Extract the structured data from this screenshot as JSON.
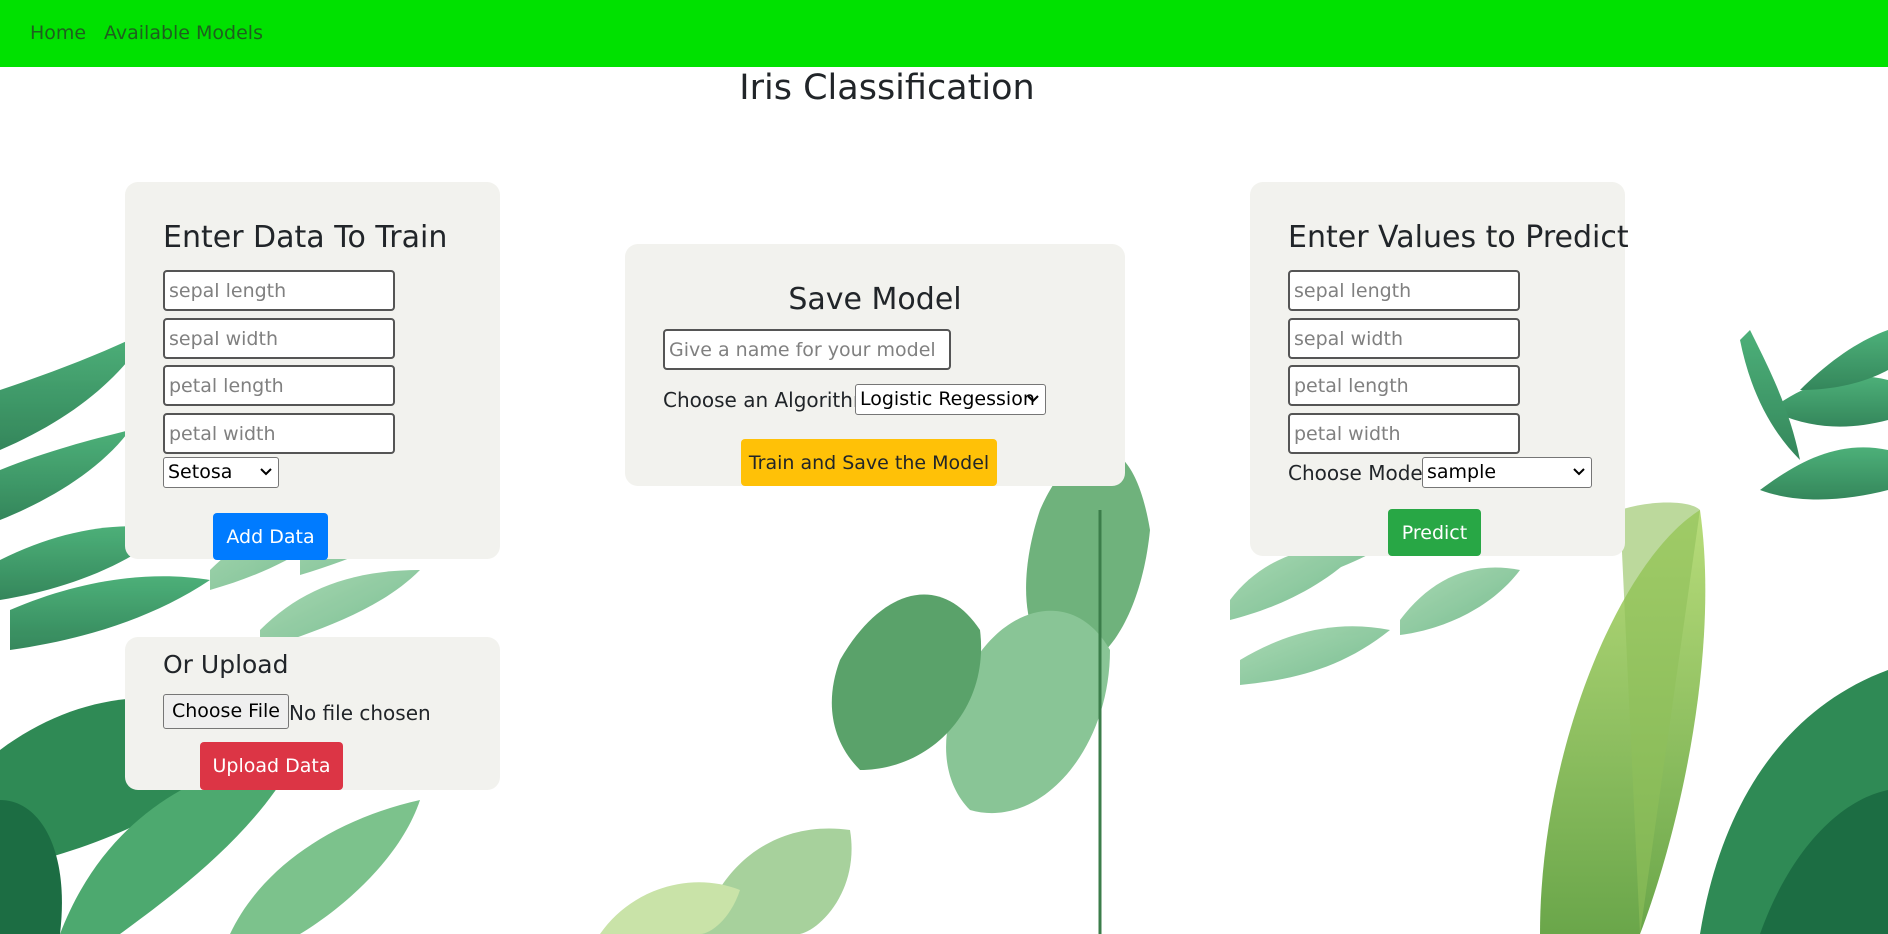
{
  "nav": {
    "home_label": "Home",
    "models_label": "Available Models"
  },
  "page": {
    "title": "Iris Classification"
  },
  "train": {
    "heading": "Enter Data To Train",
    "sepal_length_placeholder": "sepal length",
    "sepal_width_placeholder": "sepal width",
    "petal_length_placeholder": "petal length",
    "petal_width_placeholder": "petal width",
    "species_selected": "Setosa",
    "add_button": "Add Data"
  },
  "upload": {
    "heading": "Or Upload",
    "choose_file_label": "Choose File",
    "file_status": "No file chosen",
    "upload_button": "Upload Data"
  },
  "save": {
    "heading": "Save Model",
    "name_placeholder": "Give a name for your model",
    "algorithm_label": "Choose an Algorithm",
    "algorithm_selected": "Logistic Regession",
    "train_button": "Train and Save the Model"
  },
  "predict": {
    "heading": "Enter Values to Predict",
    "sepal_length_placeholder": "sepal length",
    "sepal_width_placeholder": "sepal width",
    "petal_length_placeholder": "petal length",
    "petal_width_placeholder": "petal width",
    "model_label": "Choose Model",
    "model_selected": "sample",
    "predict_button": "Predict"
  },
  "colors": {
    "navbar": "#00e100",
    "card": "#f2f2ee",
    "add_button": "#007bff",
    "upload_button": "#dc3545",
    "train_button": "#ffc107",
    "predict_button": "#28a745"
  },
  "icons": {
    "select_arrow": "chevron-down-icon",
    "background": "tropical-leaves-illustration"
  }
}
